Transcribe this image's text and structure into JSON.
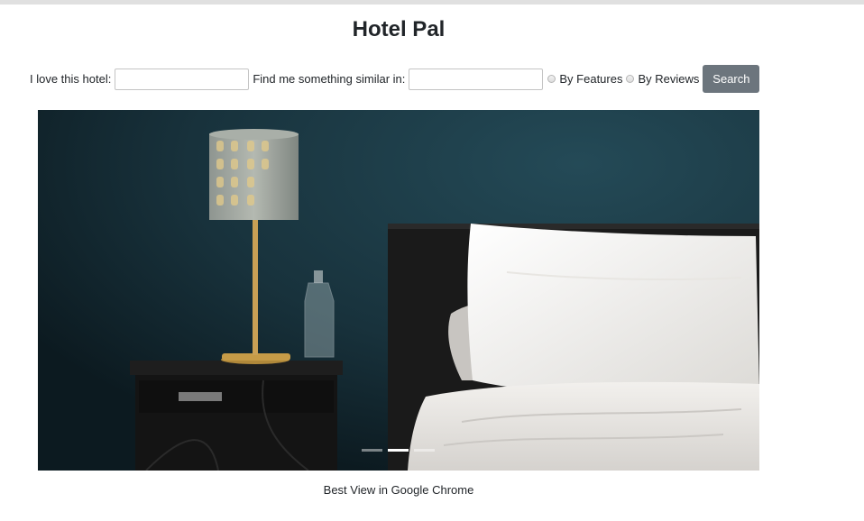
{
  "app": {
    "title": "Hotel Pal"
  },
  "search": {
    "love_label": "I love this hotel:",
    "love_value": "",
    "similar_label": "Find me something similar in:",
    "similar_value": "",
    "options": [
      {
        "label": "By Features",
        "selected": false
      },
      {
        "label": "By Reviews",
        "selected": false
      }
    ],
    "button_label": "Search"
  },
  "carousel": {
    "image_icon": "bedroom-photo",
    "slide_count": 3,
    "active_index": 1
  },
  "footer": {
    "text": "Best View in Google Chrome"
  },
  "colors": {
    "button_bg": "#6c757d",
    "wall": "#1b3a46"
  }
}
